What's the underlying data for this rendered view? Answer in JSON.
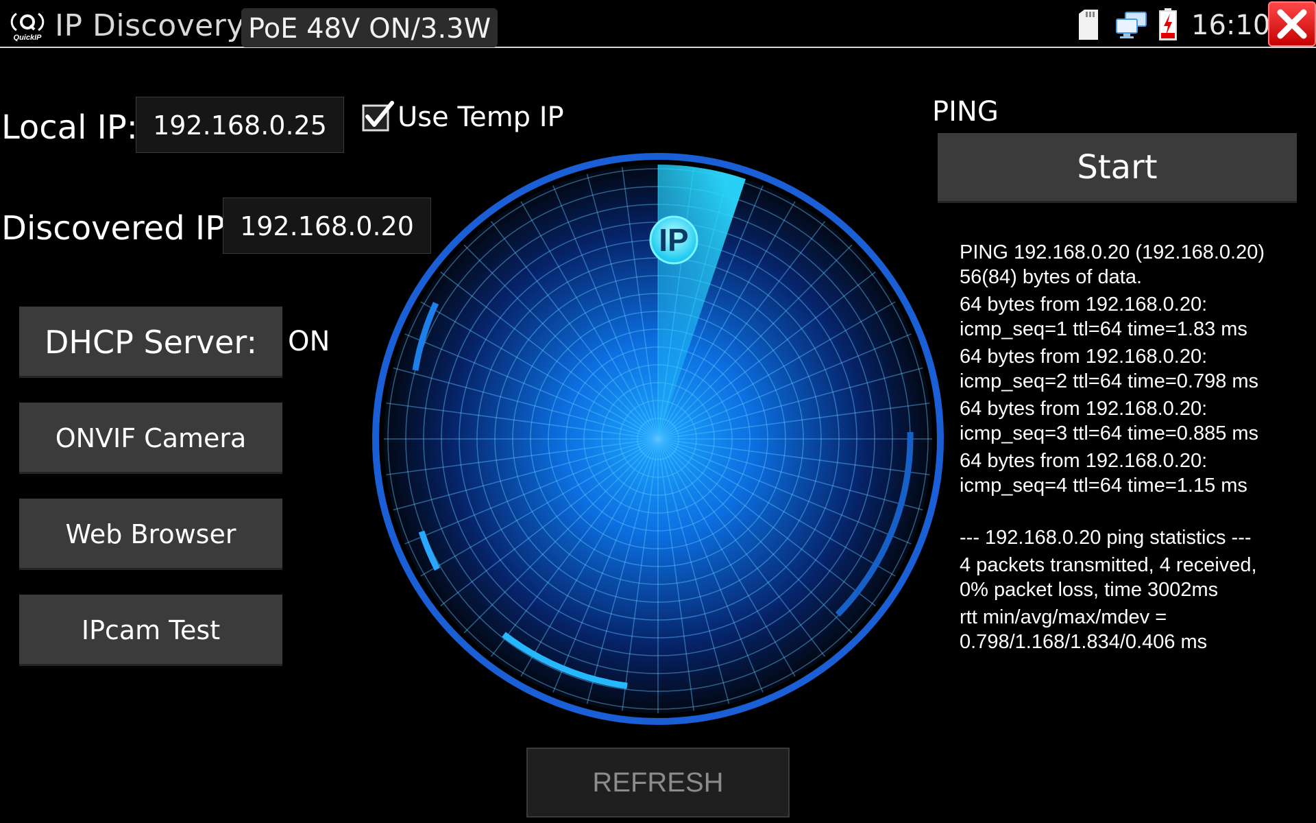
{
  "header": {
    "logo_text": "QuickIP",
    "app_title": "IP Discovery",
    "poe_status": "PoE 48V ON/3.3W",
    "clock": "16:10",
    "icons": [
      "sd-card-icon",
      "network-icon",
      "battery-charging-icon",
      "close-icon"
    ]
  },
  "left": {
    "local_ip_label": "Local IP:",
    "local_ip_value": "192.168.0.25",
    "use_temp_ip_label": "Use Temp IP",
    "use_temp_ip_checked": true,
    "discovered_ip_label": "Discovered IP:",
    "discovered_ip_value": "192.168.0.20",
    "dhcp_button_label": "DHCP Server:",
    "dhcp_status": "ON",
    "onvif_button_label": "ONVIF Camera",
    "web_browser_button_label": "Web Browser",
    "ipcam_test_button_label": "IPcam Test"
  },
  "radar": {
    "badge": "IP",
    "colors": {
      "accent": "#1e8fff",
      "sweep": "#25d6ff",
      "ring": "#1a5fd6"
    }
  },
  "ping": {
    "label": "PING",
    "start_label": "Start",
    "output": {
      "l1": "PING 192.168.0.20 (192.168.0.20)",
      "l2": "56(84) bytes of data.",
      "l3": "64 bytes from 192.168.0.20:",
      "l4": "icmp_seq=1 ttl=64 time=1.83 ms",
      "l5": "64 bytes from 192.168.0.20:",
      "l6": "icmp_seq=2 ttl=64 time=0.798 ms",
      "l7": "64 bytes from 192.168.0.20:",
      "l8": "icmp_seq=3 ttl=64 time=0.885 ms",
      "l9": "64 bytes from 192.168.0.20:",
      "l10": "icmp_seq=4 ttl=64 time=1.15 ms",
      "l11": "--- 192.168.0.20 ping statistics ---",
      "l12": "4 packets transmitted, 4 received,",
      "l13": "0% packet loss, time 3002ms",
      "l14": "rtt min/avg/max/mdev =",
      "l15": "0.798/1.168/1.834/0.406 ms"
    }
  },
  "footer": {
    "refresh_label": "REFRESH"
  }
}
